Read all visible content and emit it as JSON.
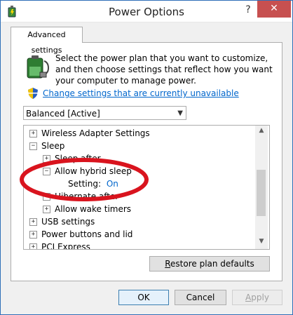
{
  "window": {
    "title": "Power Options",
    "help": "?",
    "close": "✕"
  },
  "tab": {
    "label": "Advanced settings"
  },
  "description": "Select the power plan that you want to customize, and then choose settings that reflect how you want your computer to manage power.",
  "change_link": "Change settings that are currently unavailable",
  "plan_select": {
    "value": "Balanced [Active]"
  },
  "tree": {
    "wireless": "Wireless Adapter Settings",
    "sleep": "Sleep",
    "sleep_after": "Sleep after",
    "allow_hybrid": "Allow hybrid sleep",
    "setting_label": "Setting:",
    "setting_value": "On",
    "hibernate_after": "Hibernate after",
    "allow_wake": "Allow wake timers",
    "usb": "USB settings",
    "power_buttons": "Power buttons and lid",
    "pci": "PCI Express"
  },
  "buttons": {
    "restore_first": "R",
    "restore_rest": "estore plan defaults",
    "ok": "OK",
    "cancel": "Cancel",
    "apply_first": "A",
    "apply_rest": "pply"
  },
  "colors": {
    "link": "#0066cc",
    "close": "#c75050",
    "highlight_ellipse": "#d9141e"
  },
  "icons": {
    "app": "power-options-icon",
    "battery": "battery-plug-icon",
    "shield": "uac-shield-icon"
  }
}
